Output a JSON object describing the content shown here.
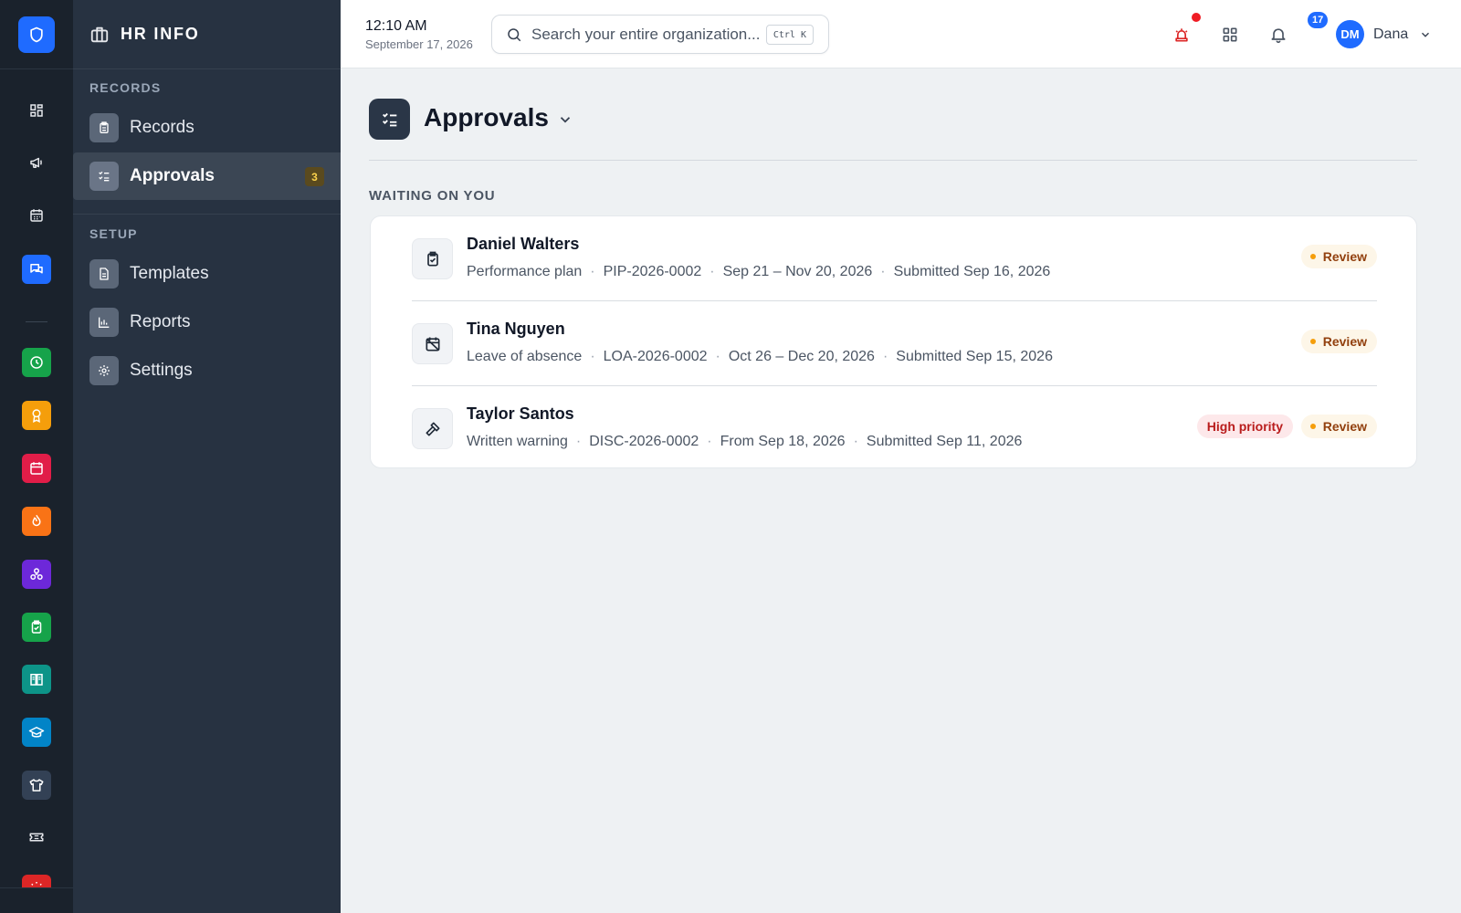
{
  "app": {
    "title": "HR INFO"
  },
  "sidebar": {
    "sections": [
      {
        "label": "RECORDS"
      },
      {
        "label": "SETUP"
      }
    ],
    "items": [
      {
        "label": "Records",
        "icon": "clipboard-list-icon"
      },
      {
        "label": "Approvals",
        "icon": "checklist-icon",
        "badge": "3",
        "active": true
      },
      {
        "label": "Templates",
        "icon": "document-icon"
      },
      {
        "label": "Reports",
        "icon": "bar-chart-icon"
      },
      {
        "label": "Settings",
        "icon": "gear-icon"
      }
    ]
  },
  "rail": {
    "icons": [
      "shield-icon",
      "dashboard-icon",
      "megaphone-icon",
      "calendar-icon",
      "chat-icon",
      "clock-icon",
      "award-icon",
      "calendar-red-icon",
      "flame-icon",
      "network-icon",
      "clipboard-check-icon",
      "book-icon",
      "graduation-cap-icon",
      "shirt-icon",
      "ticket-icon",
      "alarm-icon"
    ],
    "colors": {
      "shield": "#1f6bff",
      "chat": "#1f6bff",
      "clock": "#16a34a",
      "award": "#f59e0b",
      "calendar_red": "#e11d48",
      "flame": "#f97316",
      "network": "#6d28d9",
      "clipboard_check": "#16a34a",
      "book": "#0d9488",
      "graduation": "#0284c7",
      "shirt": "#334155",
      "alarm": "#dc2626"
    }
  },
  "header": {
    "time": "12:10 AM",
    "date": "September 17, 2026",
    "search_placeholder": "Search your entire organization...",
    "search_shortcut": "Ctrl K",
    "notifications_count": "17",
    "user_initials": "DM",
    "user_name": "Dana"
  },
  "page": {
    "title": "Approvals",
    "group_label": "WAITING ON YOU"
  },
  "approvals": [
    {
      "name": "Daniel Walters",
      "type": "Performance plan",
      "id": "PIP-2026-0002",
      "period": "Sep 21 – Nov 20, 2026",
      "submitted": "Submitted Sep 16, 2026",
      "status": "Review",
      "icon": "clipboard-check-icon"
    },
    {
      "name": "Tina Nguyen",
      "type": "Leave of absence",
      "id": "LOA-2026-0002",
      "period": "Oct 26 – Dec 20, 2026",
      "submitted": "Submitted Sep 15, 2026",
      "status": "Review",
      "icon": "calendar-off-icon"
    },
    {
      "name": "Taylor Santos",
      "type": "Written warning",
      "id": "DISC-2026-0002",
      "period": "From Sep 18, 2026",
      "submitted": "Submitted Sep 11, 2026",
      "status": "Review",
      "priority": "High priority",
      "icon": "gavel-icon"
    }
  ],
  "colors": {
    "accent": "#1f6bff",
    "sidebar_bg": "#273241",
    "rail_bg": "#1a222c",
    "review_pill": "#fdf6e8",
    "priority_pill": "#fde8ea"
  }
}
